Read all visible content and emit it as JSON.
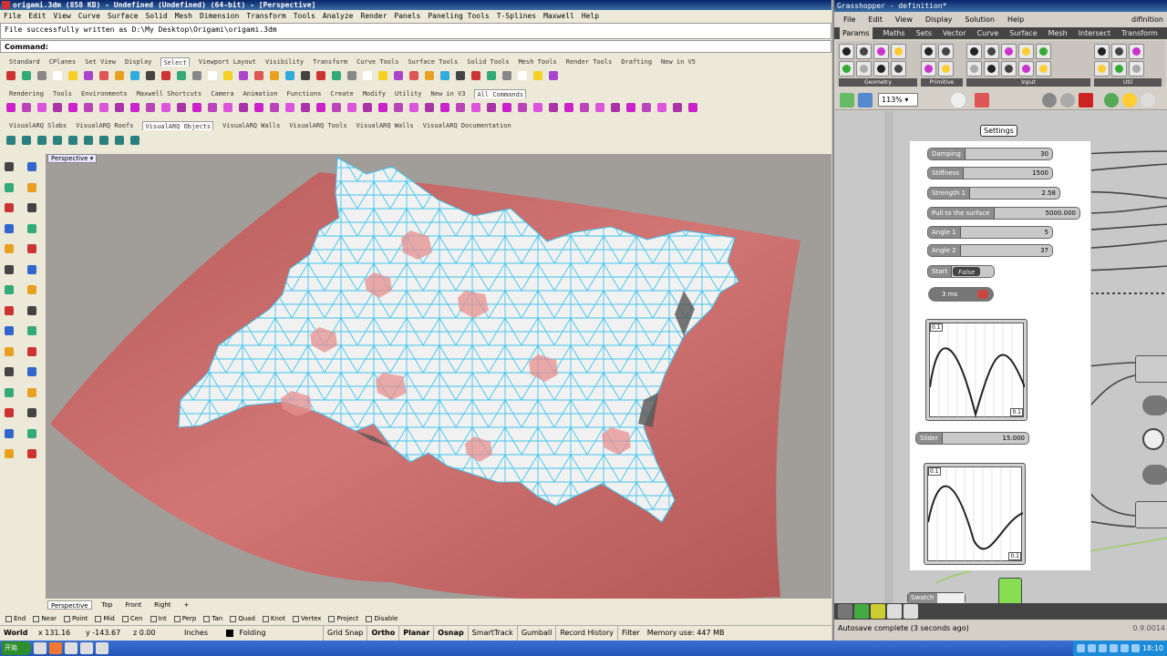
{
  "rhino": {
    "title": "origami.3dm (858 KB) - Undefined (Undefined) (64-bit) - [Perspective]",
    "menu": [
      "File",
      "Edit",
      "View",
      "Curve",
      "Surface",
      "Solid",
      "Mesh",
      "Dimension",
      "Transform",
      "Tools",
      "Analyze",
      "Render",
      "Panels",
      "Paneling Tools",
      "T-Splines",
      "Maxwell",
      "Help"
    ],
    "history": "File successfully written as D:\\My Desktop\\Origami\\origami.3dm",
    "command_label": "Command:",
    "tabs1": [
      "Standard",
      "CPlanes",
      "Set View",
      "Display",
      "Select",
      "Viewport Layout",
      "Visibility",
      "Transform",
      "Curve Tools",
      "Surface Tools",
      "Solid Tools",
      "Mesh Tools",
      "Render Tools",
      "Drafting",
      "New in V5"
    ],
    "tabs1_active": "Select",
    "tabs2": [
      "Rendering",
      "Tools",
      "Environments",
      "Maxwell Shortcuts",
      "Camera",
      "Animation",
      "Functions",
      "Create",
      "Modify",
      "Utility",
      "New in V3",
      "All Commands"
    ],
    "tabs2_active": "All Commands",
    "tabs3": [
      "VisualARQ Slabs",
      "VisualARQ Roofs",
      "VisualARQ Objects",
      "VisualARQ Walls",
      "VisualARQ Tools",
      "VisualARQ Walls",
      "VisualARQ Documentation"
    ],
    "tabs3_active": "VisualARQ Objects",
    "viewport_title": "Perspective",
    "viewport_tabs": [
      "Perspective",
      "Top",
      "Front",
      "Right"
    ],
    "viewport_tab_add": "+",
    "osnaps": [
      "End",
      "Near",
      "Point",
      "Mid",
      "Cen",
      "Int",
      "Perp",
      "Tan",
      "Quad",
      "Knot",
      "Vertex",
      "Project",
      "Disable"
    ],
    "status": {
      "cplane": "World",
      "x": "x 131.16",
      "y": "y -143.67",
      "z": "z 0.00",
      "units": "Inches",
      "layer": "Folding",
      "grid_snap": "Grid Snap",
      "ortho": "Ortho",
      "planar": "Planar",
      "osnap": "Osnap",
      "smarttrack": "SmartTrack",
      "gumball": "Gumball",
      "record_history": "Record History",
      "filter": "Filter",
      "memory": "Memory use: 447 MB"
    },
    "colors": {
      "plane": "#c96a6a",
      "mesh": "#f2f2f2",
      "edges": "#3ec4ec",
      "viewport_bg": "#a19e9a"
    }
  },
  "grasshopper": {
    "title": "Grasshopper - definition*",
    "menu": [
      "File",
      "Edit",
      "View",
      "Display",
      "Solution",
      "Help"
    ],
    "menu_right": "difinition",
    "tabs": [
      "Params",
      "Maths",
      "Sets",
      "Vector",
      "Curve",
      "Surface",
      "Mesh",
      "Intersect",
      "Transform",
      "E"
    ],
    "tabs_active": "Params",
    "groups": [
      "Geometry",
      "Primitive",
      "Input",
      "Util"
    ],
    "zoom": "113%",
    "group_label": "Settings",
    "sliders": [
      {
        "name": "Damping",
        "value": "30"
      },
      {
        "name": "Stiffness",
        "value": "1500"
      },
      {
        "name": "Strength 1",
        "value": "2.58"
      },
      {
        "name": "Pull to the surface",
        "value": "5000.000"
      },
      {
        "name": "Angle 1",
        "value": "5"
      },
      {
        "name": "Angle 2",
        "value": "37"
      }
    ],
    "toggle": {
      "name": "Start",
      "value": "False"
    },
    "timer": "3 ms",
    "slider2": {
      "name": "Slider",
      "value": "15.000"
    },
    "graph_top": "0.1",
    "graph_bottom": "0.1",
    "swatch": "Swatch",
    "status": "Autosave complete (3 seconds ago)",
    "version": "0.9.0014"
  },
  "taskbar": {
    "start": "开始",
    "time": "18:10"
  }
}
